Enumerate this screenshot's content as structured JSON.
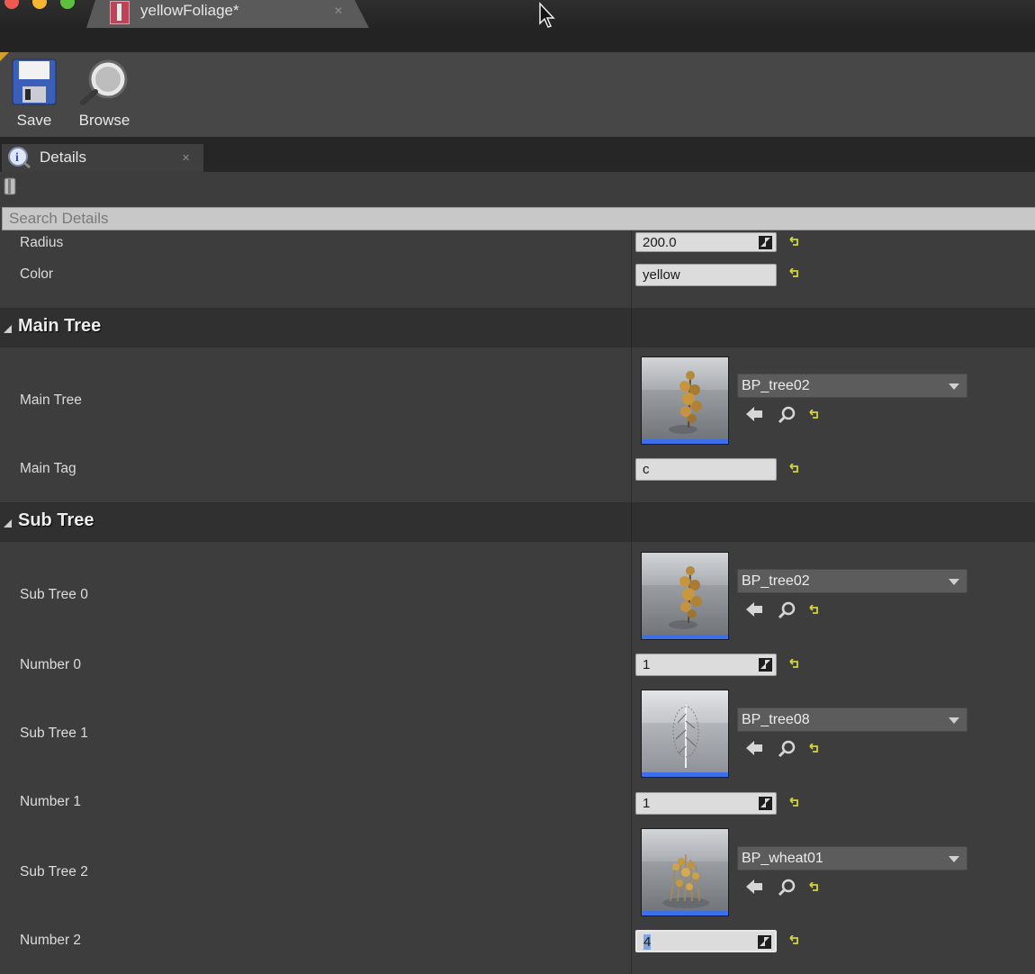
{
  "window": {
    "tab_title": "yellowFoliage*"
  },
  "toolbar": {
    "save_label": "Save",
    "browse_label": "Browse"
  },
  "details_tab": {
    "label": "Details"
  },
  "search": {
    "placeholder": "Search Details"
  },
  "properties": {
    "radius": {
      "label": "Radius",
      "value": "200.0"
    },
    "color": {
      "label": "Color",
      "value": "yellow"
    }
  },
  "main_tree_section": {
    "title": "Main Tree",
    "main_tree": {
      "label": "Main Tree",
      "asset": "BP_tree02"
    },
    "main_tag": {
      "label": "Main Tag",
      "value": "c"
    }
  },
  "sub_tree_section": {
    "title": "Sub Tree",
    "sub_tree_0": {
      "label": "Sub Tree 0",
      "asset": "BP_tree02"
    },
    "number_0": {
      "label": "Number 0",
      "value": "1"
    },
    "sub_tree_1": {
      "label": "Sub Tree 1",
      "asset": "BP_tree08"
    },
    "number_1": {
      "label": "Number 1",
      "value": "1"
    },
    "sub_tree_2": {
      "label": "Sub Tree 2",
      "asset": "BP_wheat01"
    },
    "number_2": {
      "label": "Number 2",
      "value": "4"
    }
  },
  "colors": {
    "accent_blue": "#3c6fe8",
    "reset_yellow": "#d4d43a",
    "tab_icon": "#c04256"
  }
}
